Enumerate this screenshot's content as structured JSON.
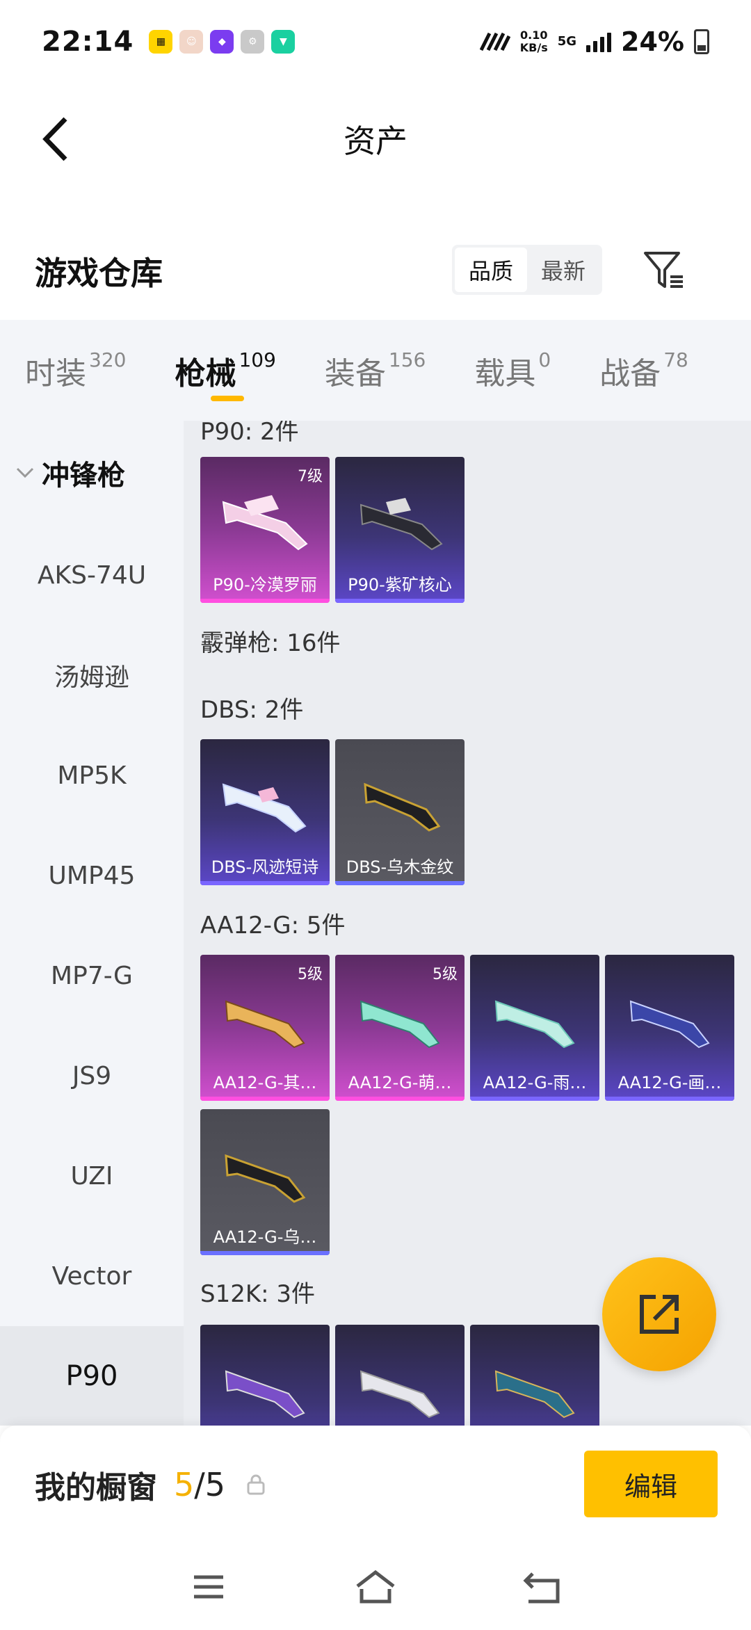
{
  "status_bar": {
    "time": "22:14",
    "net_speed_value": "0.10",
    "net_speed_unit": "KB/s",
    "network": "5G",
    "battery": "24%"
  },
  "header": {
    "title": "资产"
  },
  "warehouse": {
    "title": "游戏仓库",
    "sort_options": [
      "品质",
      "最新"
    ]
  },
  "category_tabs": [
    {
      "label": "时装",
      "count": "320"
    },
    {
      "label": "枪械",
      "count": "109"
    },
    {
      "label": "装备",
      "count": "156"
    },
    {
      "label": "载具",
      "count": "0"
    },
    {
      "label": "战备",
      "count": "78"
    }
  ],
  "sidebar": {
    "group": "冲锋枪",
    "items": [
      "AKS-74U",
      "汤姆逊",
      "MP5K",
      "UMP45",
      "MP7-G",
      "JS9",
      "UZI",
      "Vector",
      "P90"
    ]
  },
  "content": {
    "sections": [
      {
        "title": "P90: 2件",
        "items": [
          {
            "name": "P90-冷漠罗丽",
            "level": "7级",
            "quality": "pink"
          },
          {
            "name": "P90-紫矿核心",
            "level": "",
            "quality": "purple"
          }
        ]
      },
      {
        "title": "霰弹枪: 16件",
        "items": []
      },
      {
        "title": "DBS: 2件",
        "items": [
          {
            "name": "DBS-风迹短诗",
            "level": "",
            "quality": "purple"
          },
          {
            "name": "DBS-乌木金纹",
            "level": "",
            "quality": "gray"
          }
        ]
      },
      {
        "title": "AA12-G: 5件",
        "items": [
          {
            "name": "AA12-G-其…",
            "level": "5级",
            "quality": "pink"
          },
          {
            "name": "AA12-G-萌…",
            "level": "5级",
            "quality": "pink"
          },
          {
            "name": "AA12-G-雨…",
            "level": "",
            "quality": "purple"
          },
          {
            "name": "AA12-G-画…",
            "level": "",
            "quality": "purple"
          },
          {
            "name": "AA12-G-乌…",
            "level": "",
            "quality": "gray"
          }
        ]
      },
      {
        "title": "S12K: 3件",
        "items": [
          {
            "name": "",
            "level": "",
            "quality": "purple"
          },
          {
            "name": "",
            "level": "",
            "quality": "purple"
          },
          {
            "name": "",
            "level": "",
            "quality": "purple"
          }
        ]
      }
    ]
  },
  "showcase": {
    "title": "我的橱窗",
    "current": "5",
    "separator_total": "/5",
    "edit_label": "编辑"
  },
  "icons": {
    "back": "back-arrow-icon",
    "filter": "filter-icon",
    "share": "share-icon",
    "lock": "lock-icon",
    "menu": "menu-icon",
    "home": "home-icon",
    "return": "return-icon"
  }
}
